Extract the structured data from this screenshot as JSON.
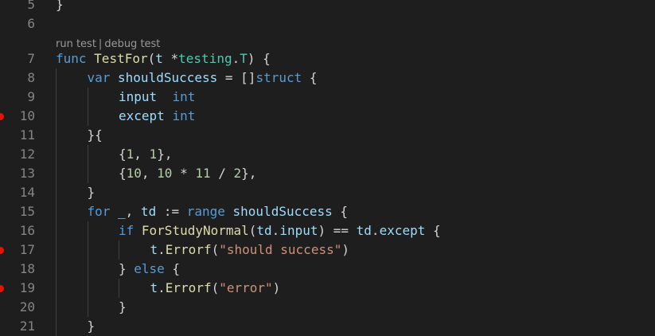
{
  "lines": [
    {
      "n": "5",
      "bp": false,
      "indent": 0,
      "tokens": [
        {
          "t": "}",
          "c": "pl"
        }
      ]
    },
    {
      "n": "6",
      "bp": false,
      "indent": 0,
      "tokens": []
    },
    {
      "lens": [
        "run test",
        "debug test"
      ]
    },
    {
      "n": "7",
      "bp": false,
      "indent": 0,
      "tokens": [
        {
          "t": "func ",
          "c": "kw"
        },
        {
          "t": "TestFor",
          "c": "fn"
        },
        {
          "t": "(",
          "c": "pl"
        },
        {
          "t": "t ",
          "c": "var"
        },
        {
          "t": "*",
          "c": "pl"
        },
        {
          "t": "testing",
          "c": "ty"
        },
        {
          "t": ".",
          "c": "pl"
        },
        {
          "t": "T",
          "c": "ty"
        },
        {
          "t": ") {",
          "c": "pl"
        }
      ]
    },
    {
      "n": "8",
      "bp": false,
      "indent": 1,
      "tokens": [
        {
          "t": "var ",
          "c": "kw"
        },
        {
          "t": "shouldSuccess",
          "c": "var"
        },
        {
          "t": " = []",
          "c": "pl"
        },
        {
          "t": "struct",
          "c": "kw"
        },
        {
          "t": " {",
          "c": "pl"
        }
      ]
    },
    {
      "n": "9",
      "bp": false,
      "indent": 2,
      "tokens": [
        {
          "t": "input  ",
          "c": "var"
        },
        {
          "t": "int",
          "c": "kw"
        }
      ]
    },
    {
      "n": "10",
      "bp": true,
      "indent": 2,
      "tokens": [
        {
          "t": "except ",
          "c": "var"
        },
        {
          "t": "int",
          "c": "kw"
        }
      ]
    },
    {
      "n": "11",
      "bp": false,
      "indent": 1,
      "tokens": [
        {
          "t": "}{",
          "c": "pl"
        }
      ]
    },
    {
      "n": "12",
      "bp": false,
      "indent": 2,
      "tokens": [
        {
          "t": "{",
          "c": "pl"
        },
        {
          "t": "1",
          "c": "num"
        },
        {
          "t": ", ",
          "c": "pl"
        },
        {
          "t": "1",
          "c": "num"
        },
        {
          "t": "},",
          "c": "pl"
        }
      ]
    },
    {
      "n": "13",
      "bp": false,
      "indent": 2,
      "tokens": [
        {
          "t": "{",
          "c": "pl"
        },
        {
          "t": "10",
          "c": "num"
        },
        {
          "t": ", ",
          "c": "pl"
        },
        {
          "t": "10",
          "c": "num"
        },
        {
          "t": " * ",
          "c": "pl"
        },
        {
          "t": "11",
          "c": "num"
        },
        {
          "t": " / ",
          "c": "pl"
        },
        {
          "t": "2",
          "c": "num"
        },
        {
          "t": "},",
          "c": "pl"
        }
      ]
    },
    {
      "n": "14",
      "bp": false,
      "indent": 1,
      "tokens": [
        {
          "t": "}",
          "c": "pl"
        }
      ]
    },
    {
      "n": "15",
      "bp": false,
      "indent": 1,
      "tokens": [
        {
          "t": "for ",
          "c": "kw"
        },
        {
          "t": "_",
          "c": "var"
        },
        {
          "t": ", ",
          "c": "pl"
        },
        {
          "t": "td",
          "c": "var"
        },
        {
          "t": " := ",
          "c": "pl"
        },
        {
          "t": "range ",
          "c": "kw"
        },
        {
          "t": "shouldSuccess",
          "c": "var"
        },
        {
          "t": " {",
          "c": "pl"
        }
      ]
    },
    {
      "n": "16",
      "bp": false,
      "indent": 2,
      "tokens": [
        {
          "t": "if ",
          "c": "kw"
        },
        {
          "t": "ForStudyNormal",
          "c": "fn"
        },
        {
          "t": "(",
          "c": "pl"
        },
        {
          "t": "td",
          "c": "var"
        },
        {
          "t": ".",
          "c": "pl"
        },
        {
          "t": "input",
          "c": "var"
        },
        {
          "t": ") == ",
          "c": "pl"
        },
        {
          "t": "td",
          "c": "var"
        },
        {
          "t": ".",
          "c": "pl"
        },
        {
          "t": "except",
          "c": "var"
        },
        {
          "t": " {",
          "c": "pl"
        }
      ]
    },
    {
      "n": "17",
      "bp": true,
      "indent": 3,
      "tokens": [
        {
          "t": "t",
          "c": "var"
        },
        {
          "t": ".",
          "c": "pl"
        },
        {
          "t": "Errorf",
          "c": "fn"
        },
        {
          "t": "(",
          "c": "pl"
        },
        {
          "t": "\"should success\"",
          "c": "str"
        },
        {
          "t": ")",
          "c": "pl"
        }
      ]
    },
    {
      "n": "18",
      "bp": false,
      "indent": 2,
      "tokens": [
        {
          "t": "} ",
          "c": "pl"
        },
        {
          "t": "else",
          "c": "kw"
        },
        {
          "t": " {",
          "c": "pl"
        }
      ]
    },
    {
      "n": "19",
      "bp": true,
      "indent": 3,
      "tokens": [
        {
          "t": "t",
          "c": "var"
        },
        {
          "t": ".",
          "c": "pl"
        },
        {
          "t": "Errorf",
          "c": "fn"
        },
        {
          "t": "(",
          "c": "pl"
        },
        {
          "t": "\"error\"",
          "c": "str"
        },
        {
          "t": ")",
          "c": "pl"
        }
      ]
    },
    {
      "n": "20",
      "bp": false,
      "indent": 2,
      "tokens": [
        {
          "t": "}",
          "c": "pl"
        }
      ]
    },
    {
      "n": "21",
      "bp": false,
      "indent": 1,
      "tokens": [
        {
          "t": "}",
          "c": "pl"
        }
      ]
    }
  ]
}
